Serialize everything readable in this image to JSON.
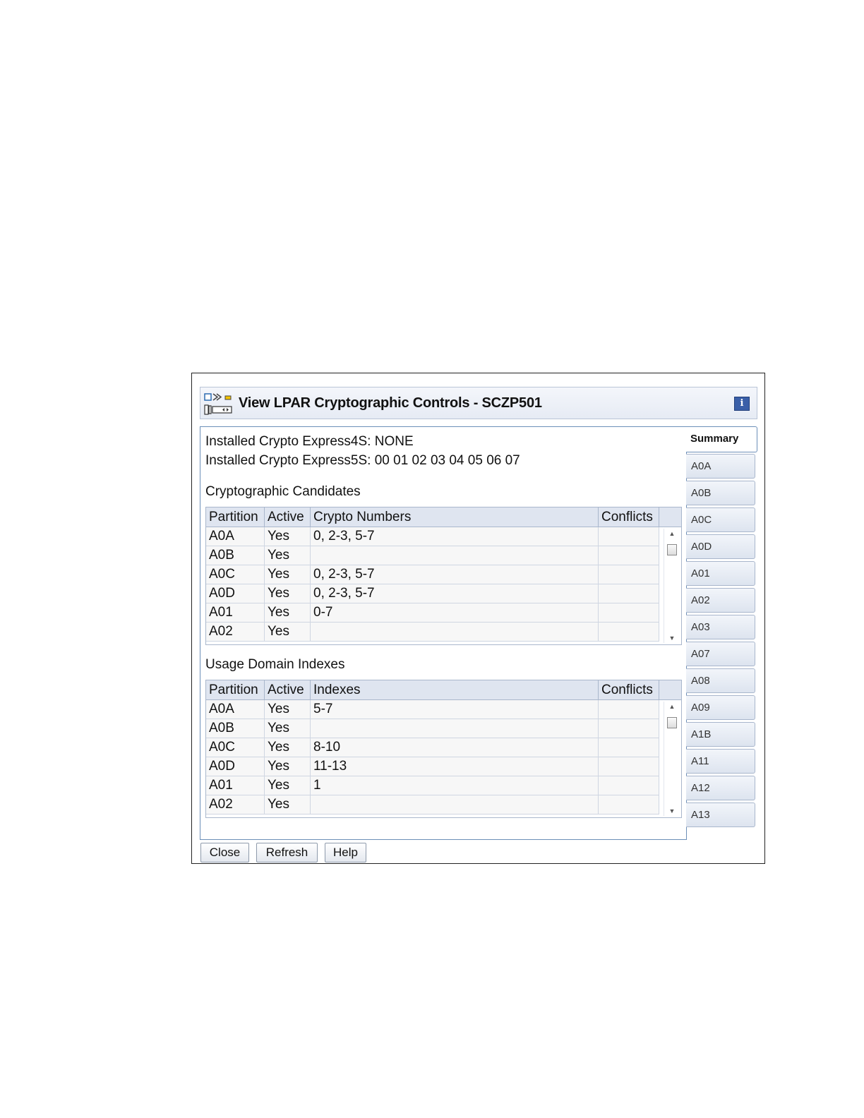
{
  "window": {
    "title": "View LPAR Cryptographic Controls - SCZP501"
  },
  "installed": [
    "Installed Crypto Express4S: NONE",
    "Installed Crypto Express5S: 00 01 02 03 04 05 06 07"
  ],
  "candidates": {
    "heading": "Cryptographic Candidates",
    "columns": [
      "Partition",
      "Active",
      "Crypto Numbers",
      "Conflicts"
    ],
    "rows": [
      [
        "A0A",
        "Yes",
        "0, 2-3, 5-7",
        ""
      ],
      [
        "A0B",
        "Yes",
        "",
        ""
      ],
      [
        "A0C",
        "Yes",
        "0, 2-3, 5-7",
        ""
      ],
      [
        "A0D",
        "Yes",
        "0, 2-3, 5-7",
        ""
      ],
      [
        "A01",
        "Yes",
        "0-7",
        ""
      ],
      [
        "A02",
        "Yes",
        "",
        ""
      ]
    ]
  },
  "usage": {
    "heading": "Usage Domain Indexes",
    "columns": [
      "Partition",
      "Active",
      "Indexes",
      "Conflicts"
    ],
    "rows": [
      [
        "A0A",
        "Yes",
        "5-7",
        ""
      ],
      [
        "A0B",
        "Yes",
        "",
        ""
      ],
      [
        "A0C",
        "Yes",
        "8-10",
        ""
      ],
      [
        "A0D",
        "Yes",
        "11-13",
        ""
      ],
      [
        "A01",
        "Yes",
        "1",
        ""
      ],
      [
        "A02",
        "Yes",
        "",
        ""
      ]
    ]
  },
  "tabs": [
    "Summary",
    "A0A",
    "A0B",
    "A0C",
    "A0D",
    "A01",
    "A02",
    "A03",
    "A07",
    "A08",
    "A09",
    "A1B",
    "A11",
    "A12",
    "A13"
  ],
  "selected_tab": "Summary",
  "buttons": {
    "close": "Close",
    "refresh": "Refresh",
    "help": "Help"
  },
  "icons": {
    "title": "lpar-crypto-icon",
    "info": "info-icon"
  },
  "colors": {
    "title_bar": "#e6ebf4",
    "header_row": "#dfe5f0",
    "panel_border": "#6c8fb8",
    "info_icon": "#3a5fa8"
  }
}
